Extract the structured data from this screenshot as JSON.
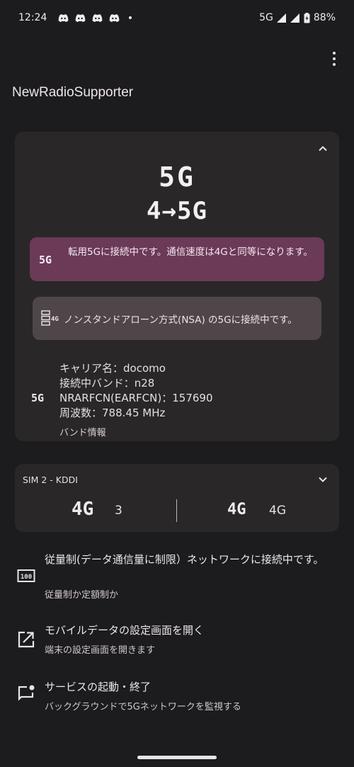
{
  "status_bar": {
    "time": "12:24",
    "notification_icons": [
      "discord-icon",
      "discord-icon",
      "discord-icon",
      "discord-icon"
    ],
    "network": "5G",
    "battery": "88%"
  },
  "app": {
    "title": "NewRadioSupporter"
  },
  "main_card": {
    "network_type": "5G",
    "network_detail": "4→5G",
    "conversion_banner": {
      "badge": "5G",
      "text": "転用5Gに接続中です。通信速度は4Gと同等になります。"
    },
    "nsa_banner": {
      "icon_label": "4G",
      "text": "ノンスタンドアローン方式(NSA) の5Gに接続中です。"
    },
    "band": {
      "badge": "5G",
      "lines": [
        "キャリア名：docomo",
        "接続中バンド：n28",
        "NRARFCN(EARFCN)：157690",
        "周波数：788.45 MHz"
      ],
      "link_label": "バンド情報"
    }
  },
  "sim_card": {
    "label": "SIM 2 - KDDI",
    "left": {
      "network": "4G",
      "value": "3"
    },
    "right": {
      "network": "4G",
      "value": "4G"
    }
  },
  "settings": [
    {
      "icon": "metered-icon",
      "title": "従量制(データ通信量に制限）ネットワークに接続中です。",
      "subtitle": "従量制か定額制か"
    },
    {
      "icon": "open-external-icon",
      "title": "モバイルデータの設定画面を開く",
      "subtitle": "端末の設定画面を開きます"
    },
    {
      "icon": "notification-message-icon",
      "title": "サービスの起動・終了",
      "subtitle": "バックグラウンドで5Gネットワークを監視する"
    }
  ]
}
